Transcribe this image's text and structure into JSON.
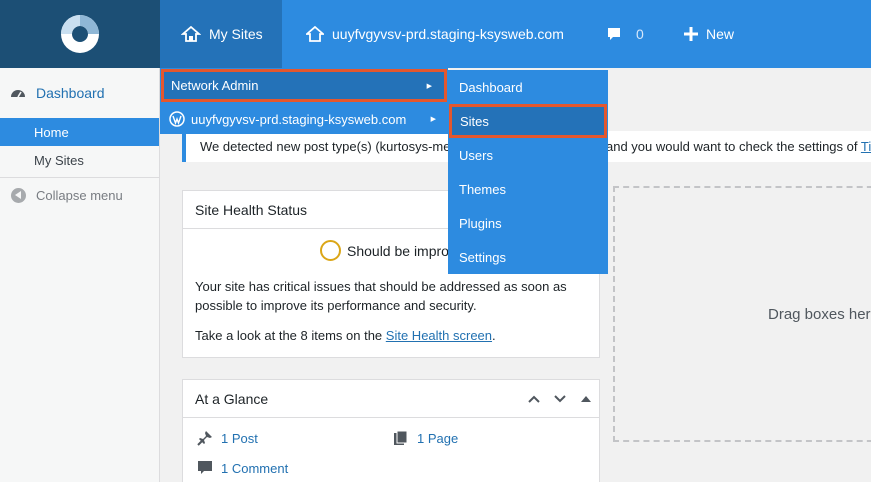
{
  "adminbar": {
    "my_sites": "My Sites",
    "site_name": "uuyfvgyvsv-prd.staging-ksysweb.com",
    "comments_count": "0",
    "new_label": "New"
  },
  "sidebar": {
    "dashboard": "Dashboard",
    "home": "Home",
    "my_sites": "My Sites",
    "collapse": "Collapse menu"
  },
  "flyout": {
    "network_admin": "Network Admin",
    "site_name": "uuyfvgyvsv-prd.staging-ksysweb.com"
  },
  "submenu": {
    "items": [
      "Dashboard",
      "Sites",
      "Users",
      "Themes",
      "Plugins",
      "Settings"
    ],
    "selected": "Sites"
  },
  "notice": {
    "text_start": "We detected new post type(s) (kurtosys-me",
    "text_end": "and you would want to check the settings of",
    "link": "Ti"
  },
  "site_health": {
    "title": "Site Health Status",
    "status": "Should be improve",
    "description": "Your site has critical issues that should be addressed as soon as possible to improve its performance and security.",
    "items_text": "Take a look at the 8 items on the",
    "items_link": "Site Health screen",
    "items_end": "."
  },
  "at_a_glance": {
    "title": "At a Glance",
    "posts": "1 Post",
    "pages": "1 Page",
    "comments": "1 Comment"
  },
  "dropzone": {
    "text": "Drag boxes her"
  },
  "colors": {
    "admin_bar": "#2d8be0",
    "highlight": "#2472b8",
    "logo_bg": "#1c4f75",
    "annotation_border": "#e4572e"
  }
}
